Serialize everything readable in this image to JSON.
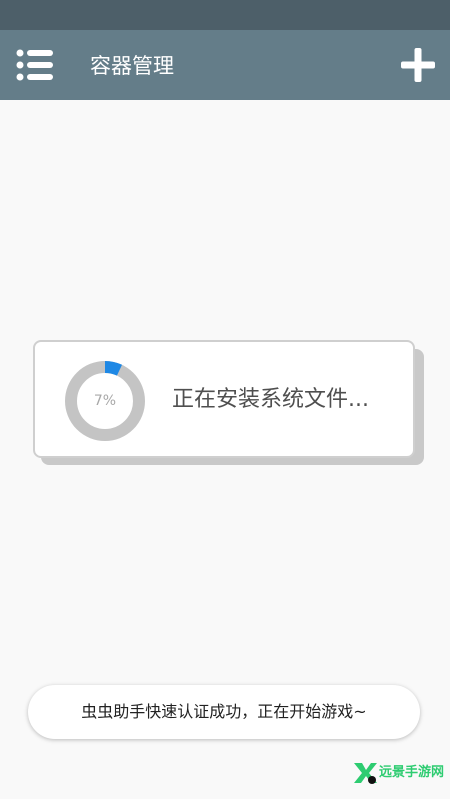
{
  "app_bar": {
    "title": "容器管理",
    "menu_icon": "list-menu-icon",
    "add_icon": "plus-icon",
    "background_color": "#647d89",
    "status_bar_color": "#4d5f69"
  },
  "dialog": {
    "progress_percent": 7,
    "progress_label": "7%",
    "message": "正在安装系统文件...",
    "progress_color": "#1e88e5",
    "track_color": "#c4c4c4"
  },
  "toast": {
    "message": "虫虫助手快速认证成功，正在开始游戏~"
  },
  "watermark": {
    "text": "远景手游网",
    "icon": "yjpk-logo-icon",
    "color": "#2ecc71"
  }
}
